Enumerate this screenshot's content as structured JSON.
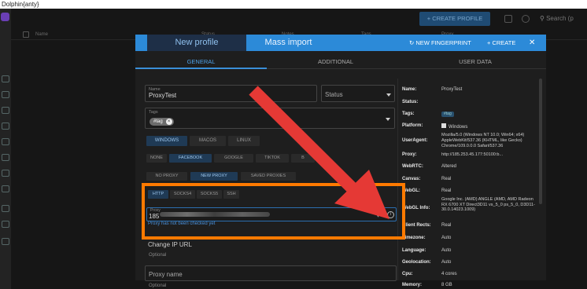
{
  "window": {
    "title": "Dolphin{anty}"
  },
  "app": {
    "create_profile": "+ CREATE PROFILE",
    "search_placeholder": "Search (p",
    "columns": [
      "Name",
      "Status",
      "Notes",
      "Tags",
      "Proxy"
    ]
  },
  "modal": {
    "tabs": [
      "New profile",
      "Mass import"
    ],
    "header_actions": {
      "new_fingerprint": "NEW FINGERPRINT",
      "create": "+ CREATE",
      "close": "✕"
    },
    "subtabs": [
      "GENERAL",
      "ADDITIONAL",
      "USER DATA"
    ],
    "name_label": "Name",
    "name_value": "ProxyTest",
    "status_placeholder": "Status",
    "tags_label": "Tags",
    "tag_chip": "#tag",
    "os_options": [
      "WINDOWS",
      "MACOS",
      "LINUX"
    ],
    "preset_options": [
      "NONE",
      "FACEBOOK",
      "GOOGLE",
      "TIKTOK",
      "B"
    ],
    "proxy_options": [
      "NO PROXY",
      "NEW PROXY",
      "SAVED PROXIES"
    ],
    "proxy_types": [
      "HTTP",
      "SOCKS4",
      "SOCKS5",
      "SSH"
    ],
    "proxy_label": "Proxy",
    "proxy_value_prefix": "185",
    "proxy_status": "Proxy has not been checked yet",
    "change_ip_label": "Change IP URL",
    "optional": "Optional",
    "proxy_name_placeholder": "Proxy name"
  },
  "summary": [
    {
      "label": "Name:",
      "value": "ProxyTest"
    },
    {
      "label": "Status:",
      "value": ""
    },
    {
      "label": "Tags:",
      "value": "#tag"
    },
    {
      "label": "Platform:",
      "value": "Windows"
    },
    {
      "label": "UserAgent:",
      "value": "Mozilla/5.0 (Windows NT 10.0; Win64; x64) AppleWebKit/537.36 (KHTML, like Gecko) Chrome/109.0.0.0 Safari/537.36"
    },
    {
      "label": "Proxy:",
      "value": "http://185.253.45.177:50100:b..."
    },
    {
      "label": "WebRTC:",
      "value": "Altered"
    },
    {
      "label": "Canvas:",
      "value": "Real"
    },
    {
      "label": "WebGL:",
      "value": "Real"
    },
    {
      "label": "WebGL Info:",
      "value": "Google Inc. (AMD) ANGLE (AMD, AMD Radeon RX 6700 XT Direct3D11 vs_5_0 ps_5_0, D3D11-30.0.14023.1009)"
    },
    {
      "label": "Client Rects:",
      "value": "Real"
    },
    {
      "label": "Timezone:",
      "value": "Auto"
    },
    {
      "label": "Language:",
      "value": "Auto"
    },
    {
      "label": "Geolocation:",
      "value": "Auto"
    },
    {
      "label": "Cpu:",
      "value": "4 cores"
    },
    {
      "label": "Memory:",
      "value": "8 GB"
    }
  ],
  "colors": {
    "accent": "#2c8ad8",
    "highlight": "#ff7a00",
    "arrow": "#e53935"
  }
}
